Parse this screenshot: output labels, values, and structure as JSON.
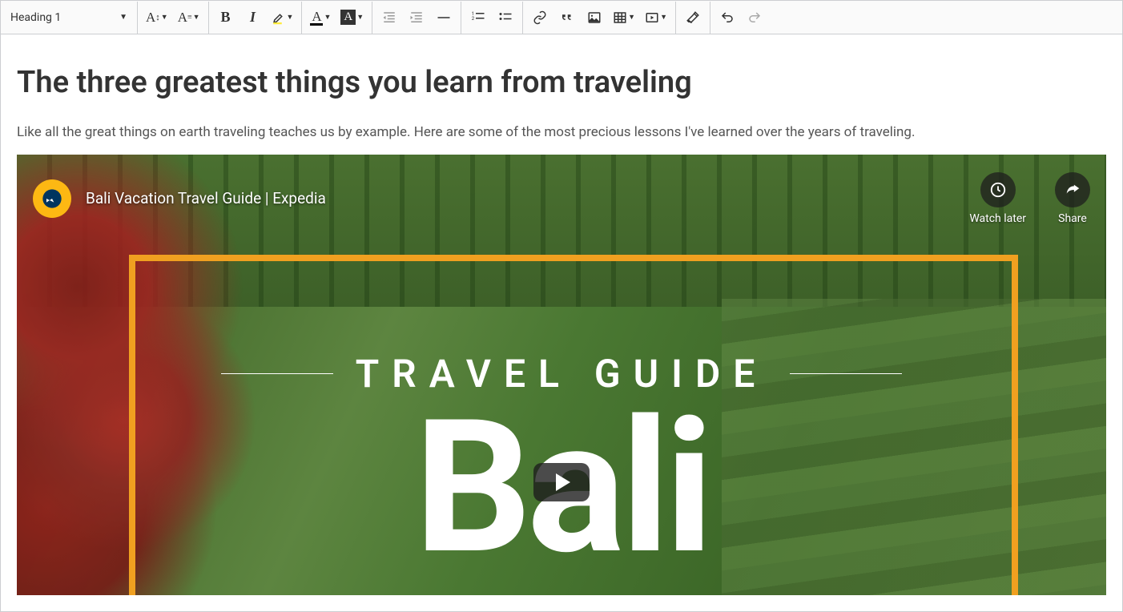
{
  "toolbar": {
    "heading_label": "Heading 1",
    "icons": {
      "font_size": "AI",
      "font_family": "A≡",
      "bold": "B",
      "italic": "I",
      "font_color": "A",
      "font_bg": "A"
    }
  },
  "content": {
    "heading": "The three greatest things you learn from traveling",
    "paragraph": "Like all the great things on earth traveling teaches us by example. Here are some of the most precious lessons I've learned over the years of traveling."
  },
  "video": {
    "channel": "Expedia",
    "title": "Bali Vacation Travel Guide | Expedia",
    "watch_later": "Watch later",
    "share": "Share",
    "overlay_subtitle": "TRAVEL GUIDE",
    "overlay_title": "Bali"
  }
}
